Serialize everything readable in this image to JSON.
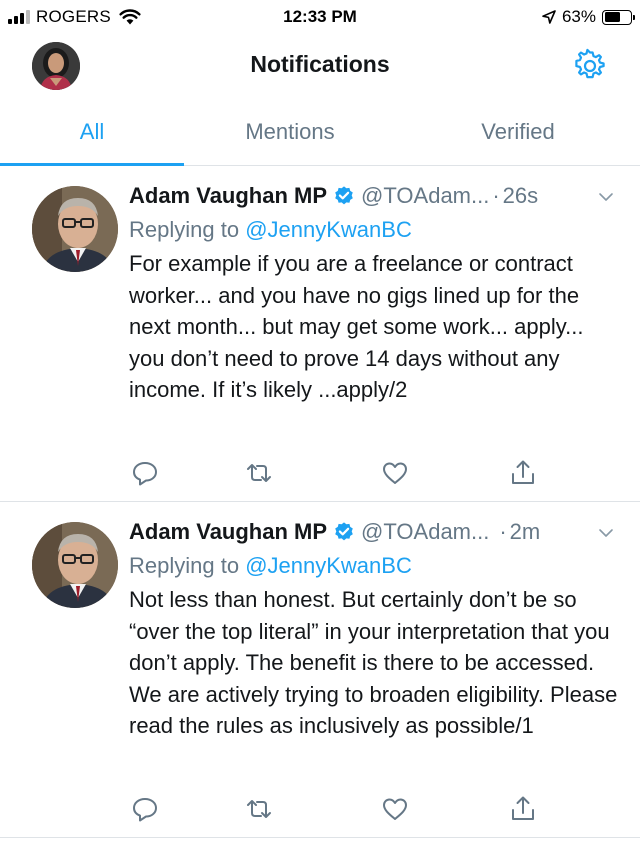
{
  "status_bar": {
    "carrier": "ROGERS",
    "time": "12:33 PM",
    "battery": "63%",
    "battery_level": 0.63,
    "icons": [
      "signal-icon",
      "wifi-icon",
      "location-arrow-icon",
      "battery-icon"
    ]
  },
  "header": {
    "title": "Notifications",
    "icons": [
      "profile-avatar",
      "gear-icon"
    ]
  },
  "tabs": [
    {
      "label": "All",
      "active": true
    },
    {
      "label": "Mentions",
      "active": false
    },
    {
      "label": "Verified",
      "active": false
    }
  ],
  "colors": {
    "accent": "#1da1f2",
    "secondary_text": "#657786",
    "primary_text": "#14171a",
    "divider": "#dfe3e7"
  },
  "tweets": [
    {
      "name": "Adam Vaughan MP",
      "handle": "@TOAdam...",
      "separator": "·",
      "time": "26s",
      "reply_prefix": "Replying to",
      "reply_to": "@JennyKwanBC",
      "text": "For example if you are a freelance or contract worker... and you have no gigs lined up for the next month... but may get some work... apply... you don’t need to prove 14 days without any income. If it’s likely ...apply/2",
      "icons": [
        "verified-badge-icon",
        "chevron-down-icon",
        "reply-icon",
        "retweet-icon",
        "like-icon",
        "share-icon"
      ]
    },
    {
      "name": "Adam Vaughan MP",
      "handle": "@TOAdam...",
      "separator": "·",
      "time": "2m",
      "reply_prefix": "Replying to",
      "reply_to": "@JennyKwanBC",
      "text": "Not less than honest. But certainly don’t be so “over the top literal” in your interpretation that you don’t apply. The benefit is there to be accessed. We are actively trying to broaden eligibility. Please read the rules as inclusively as possible/1",
      "icons": [
        "verified-badge-icon",
        "chevron-down-icon",
        "reply-icon",
        "retweet-icon",
        "like-icon",
        "share-icon"
      ]
    }
  ]
}
